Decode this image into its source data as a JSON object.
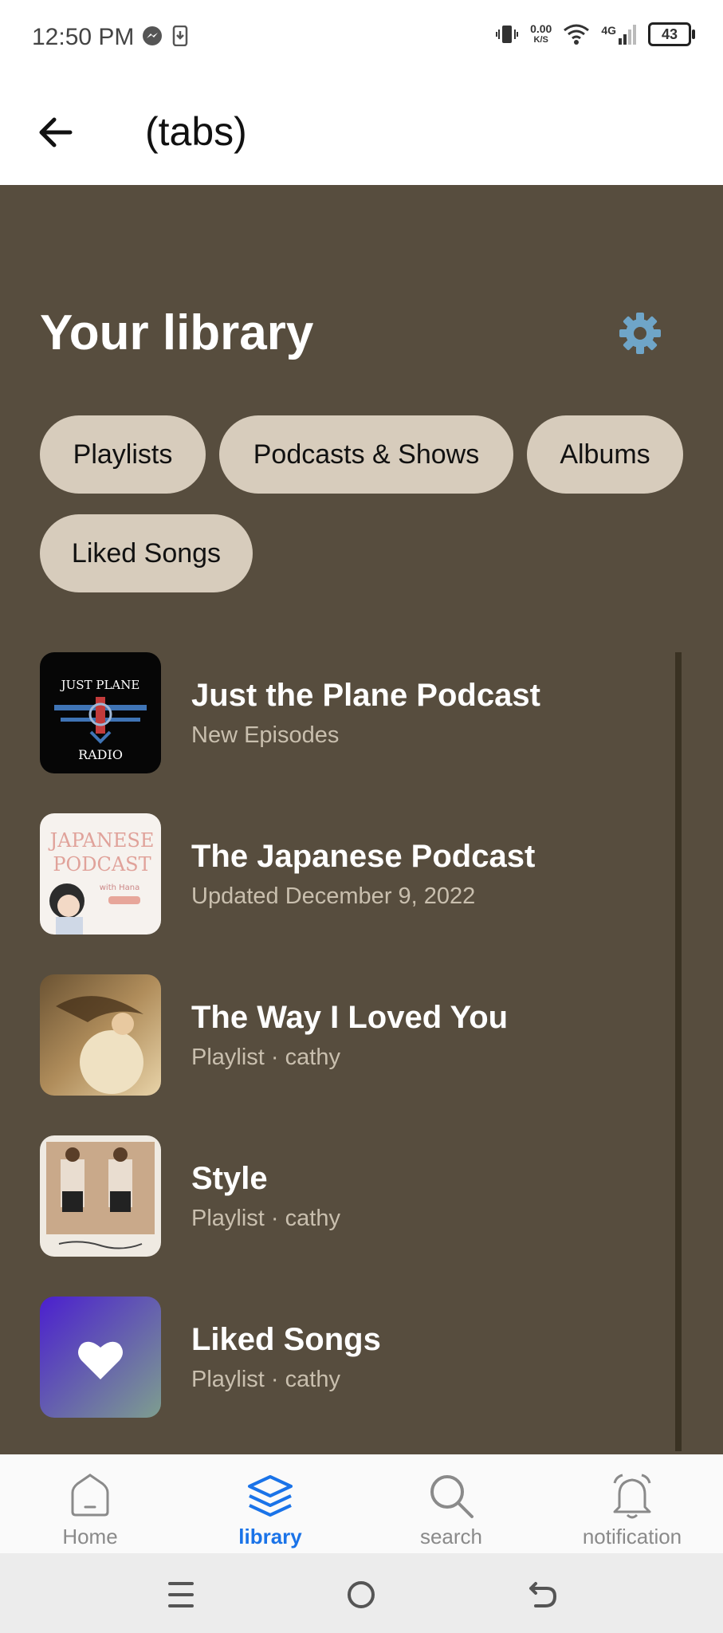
{
  "status": {
    "time": "12:50 PM",
    "net_speed_value": "0.00",
    "net_speed_unit": "K/S",
    "network": "4G",
    "battery": "43"
  },
  "app_bar": {
    "title": "(tabs)"
  },
  "library": {
    "title": "Your library"
  },
  "chips": [
    {
      "label": "Playlists"
    },
    {
      "label": "Podcasts & Shows"
    },
    {
      "label": "Albums"
    },
    {
      "label": "Liked Songs"
    }
  ],
  "items": [
    {
      "title": "Just the Plane Podcast",
      "subtitle": "New Episodes",
      "art_text_top": "JUST PLANE",
      "art_text_bottom": "RADIO"
    },
    {
      "title": "The Japanese Podcast",
      "subtitle": "Updated December 9, 2022",
      "art_text_top": "JAPANESE",
      "art_text_bottom": "PODCAST",
      "art_text_small": "with Hana"
    },
    {
      "title": "The Way I Loved You",
      "subtitle": "Playlist · cathy"
    },
    {
      "title": "Style",
      "subtitle": "Playlist · cathy"
    },
    {
      "title": "Liked Songs",
      "subtitle": "Playlist · cathy"
    }
  ],
  "nav": [
    {
      "label": "Home",
      "icon": "home-icon"
    },
    {
      "label": "library",
      "icon": "layers-icon"
    },
    {
      "label": "search",
      "icon": "search-icon"
    },
    {
      "label": "notification",
      "icon": "bell-icon"
    }
  ],
  "colors": {
    "content_bg": "#574d3e",
    "chip_bg": "#d7ccbc",
    "accent": "#1a73e8"
  }
}
